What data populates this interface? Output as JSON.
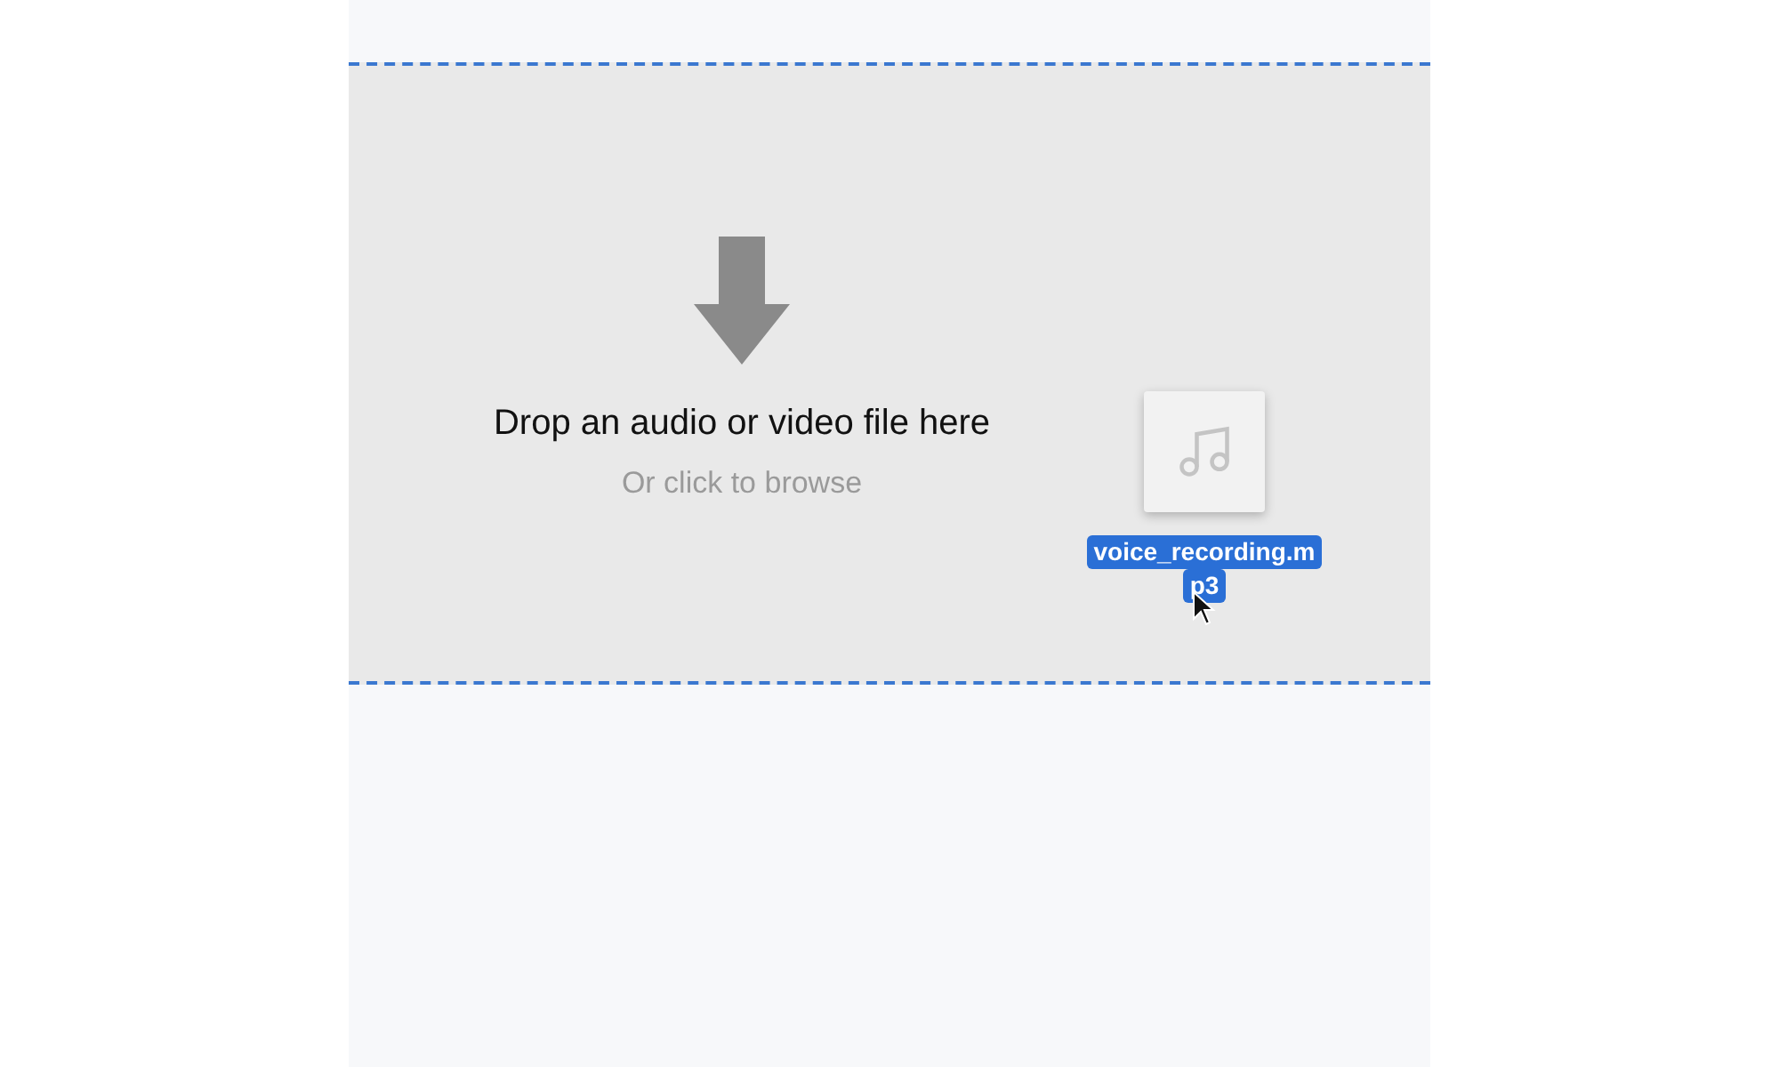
{
  "drop_zone": {
    "title": "Drop an audio or video file here",
    "subtitle": "Or click to browse"
  },
  "dragged_file": {
    "name_lines": [
      "voice_recording.m",
      "p3"
    ]
  }
}
